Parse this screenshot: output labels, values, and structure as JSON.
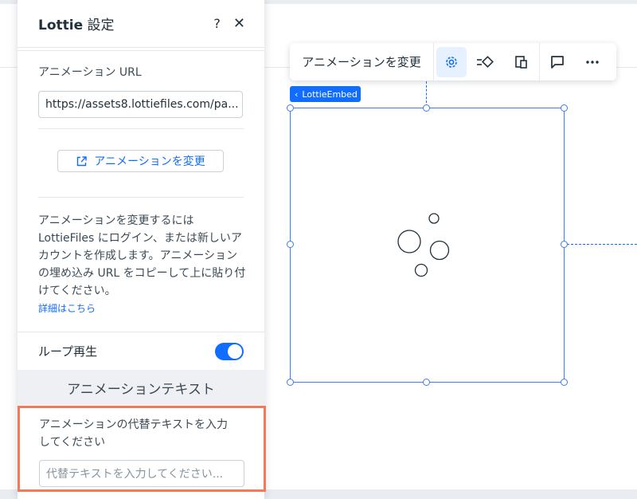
{
  "panel": {
    "title_brand": "Lottie",
    "title_rest": " 設定",
    "help_label": "?",
    "close_label": "✕",
    "url_label": "アニメーション URL",
    "url_value": "https://assets8.lottiefiles.com/pa...",
    "change_button": "アニメーションを変更",
    "description": "アニメーションを変更するには LottieFiles にログイン、または新しいアカウントを作成します。アニメーションの埋め込み URL をコピーして上に貼り付けてください。",
    "more_link": "詳細はこちら",
    "loop_label": "ループ再生",
    "loop_on": true,
    "section_header": "アニメーションテキスト",
    "alt_label": "アニメーションの代替テキストを入力してください",
    "alt_placeholder": "代替テキストを入力してください..."
  },
  "toolbar": {
    "change_label": "アニメーションを変更",
    "buttons": [
      "settings-gear-icon",
      "animation-icon",
      "layout-icon",
      "comment-icon",
      "more-icon"
    ]
  },
  "selection": {
    "tag_label": "LottieEmbed"
  },
  "colors": {
    "accent": "#116dff",
    "highlight": "#f07a5a",
    "selection": "#3b7df5"
  }
}
